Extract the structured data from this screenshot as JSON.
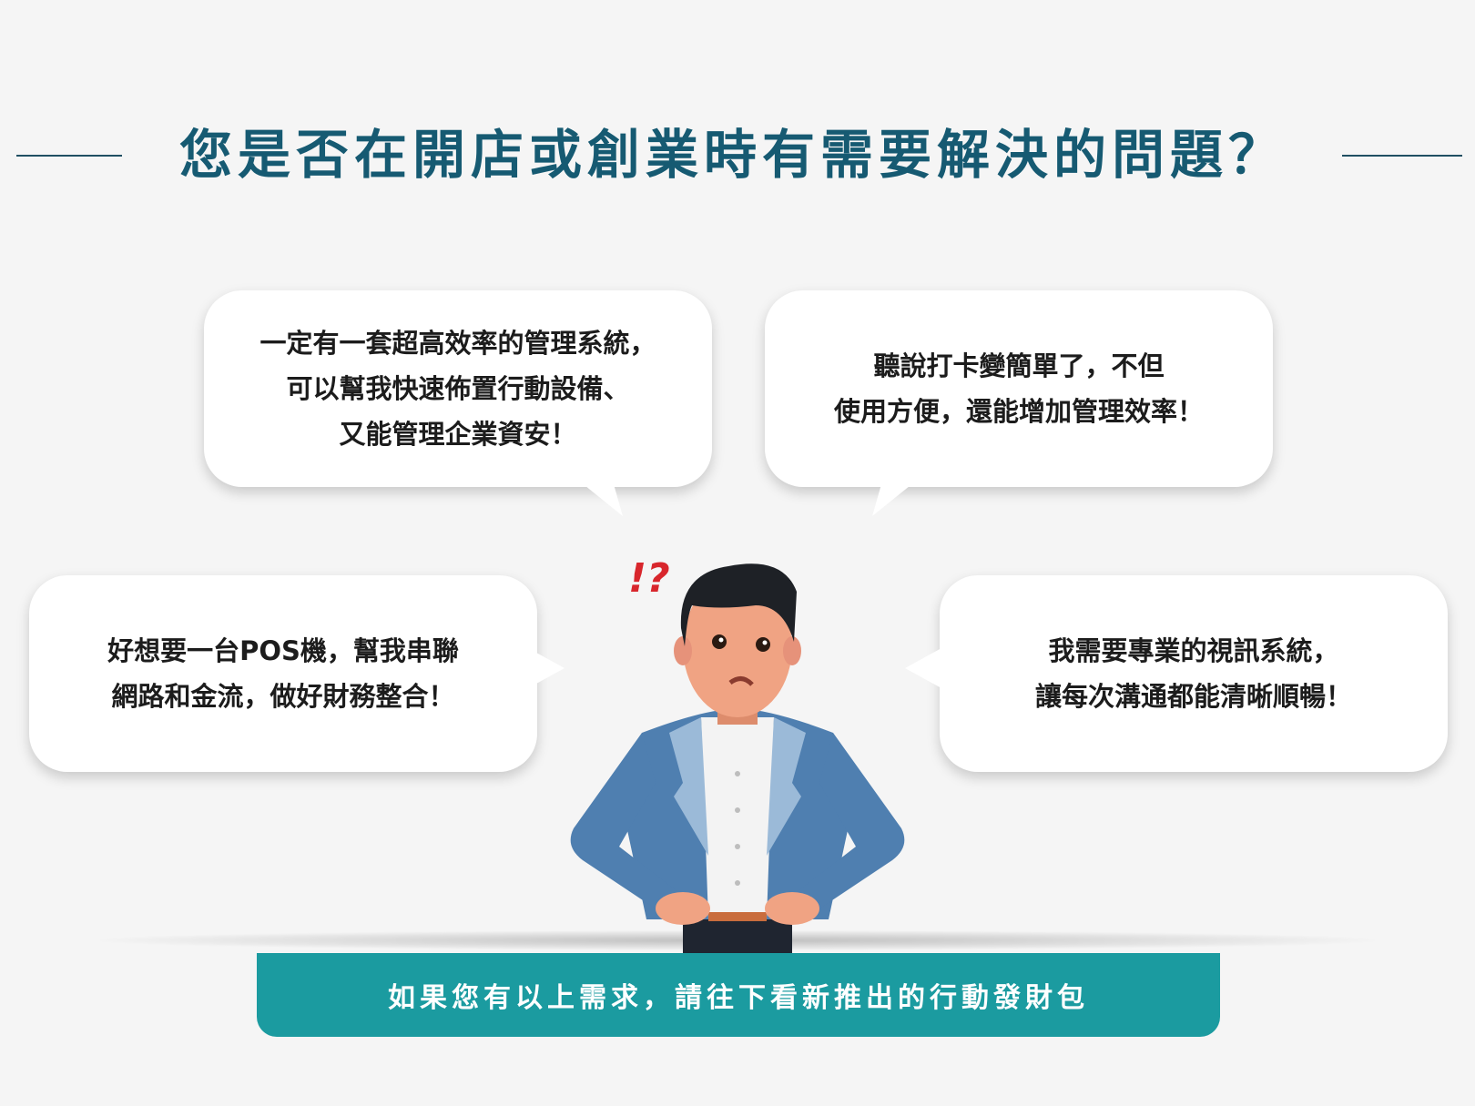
{
  "header": {
    "title": "您是否在開店或創業時有需要解決的問題？"
  },
  "bubbles": [
    {
      "text": "一定有一套超高效率的管理系統，\n可以幫我快速佈置行動設備、\n又能管理企業資安！"
    },
    {
      "text": "聽說打卡變簡單了，不但\n使用方便，還能增加管理效率！"
    },
    {
      "text": "好想要一台POS機，幫我串聯\n網路和金流，做好財務整合！"
    },
    {
      "text": "我需要專業的視訊系統，\n讓每次溝通都能清晰順暢！"
    }
  ],
  "figure": {
    "exclamation": "!?",
    "icon": "confused-businessman-illustration"
  },
  "banner": {
    "text": "如果您有以上需求，請往下看新推出的行動發財包"
  },
  "colors": {
    "title": "#165a72",
    "banner": "#1b9ba0",
    "background": "#f5f5f5",
    "jacket": "#4f7fb0",
    "lapel": "#9bbad8",
    "skin": "#f0a383",
    "hair": "#1e2126",
    "exclamation": "#d8262c"
  }
}
